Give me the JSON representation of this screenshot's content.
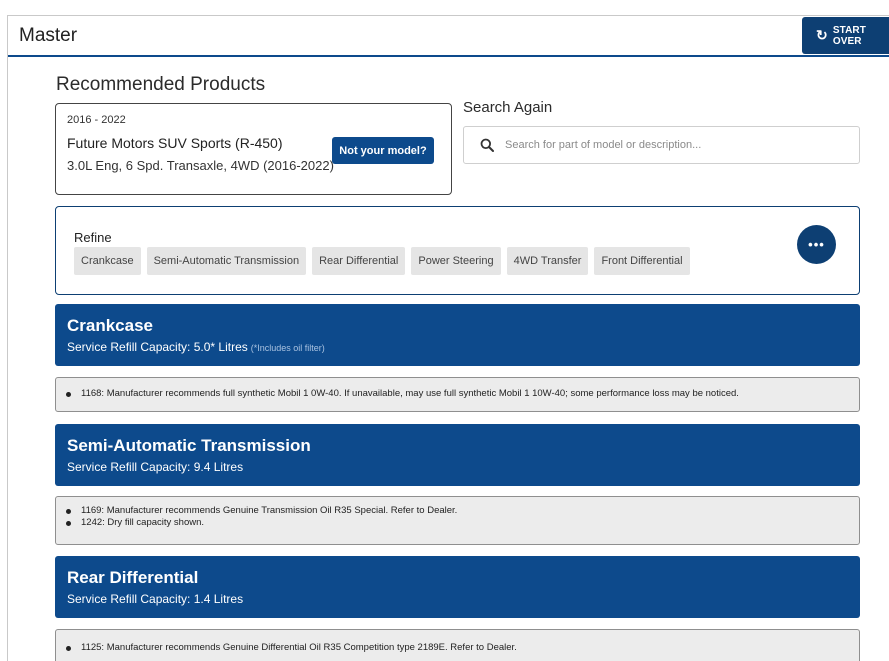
{
  "header": {
    "title": "Master",
    "start_over_label": "START OVER",
    "start_over_icon": "refresh-icon"
  },
  "recommended": {
    "title": "Recommended Products",
    "vehicle": {
      "years": "2016 - 2022",
      "model": "Future Motors SUV Sports (R-450)",
      "spec": "3.0L Eng, 6 Spd. Transaxle, 4WD (2016-2022)",
      "not_your_model_label": "Not your model?"
    }
  },
  "search": {
    "title": "Search Again",
    "placeholder": "Search for part of model or description..."
  },
  "refine": {
    "label": "Refine",
    "chips": [
      "Crankcase",
      "Semi-Automatic Transmission",
      "Rear Differential",
      "Power Steering",
      "4WD Transfer",
      "Front Differential"
    ],
    "more_label": "•••"
  },
  "sections": [
    {
      "title": "Crankcase",
      "capacity": "Service Refill Capacity: 5.0* Litres",
      "capacity_note": "(*Includes oil filter)",
      "notes": [
        "1168: Manufacturer recommends full synthetic Mobil 1 0W-40. If unavailable, may use full synthetic Mobil 1 10W-40; some performance loss may be noticed."
      ]
    },
    {
      "title": "Semi-Automatic Transmission",
      "capacity": "Service Refill Capacity: 9.4 Litres",
      "notes": [
        "1169: Manufacturer recommends Genuine Transmission Oil R35 Special. Refer to Dealer.",
        "1242: Dry fill capacity shown."
      ]
    },
    {
      "title": "Rear Differential",
      "capacity": "Service Refill Capacity: 1.4 Litres",
      "notes": [
        "1125: Manufacturer recommends Genuine Differential Oil R35 Competition type 2189E. Refer to Dealer."
      ]
    }
  ],
  "colors": {
    "primary": "#0d4a8c",
    "dark_primary": "#0d3f73",
    "note_bg": "#ececec"
  }
}
